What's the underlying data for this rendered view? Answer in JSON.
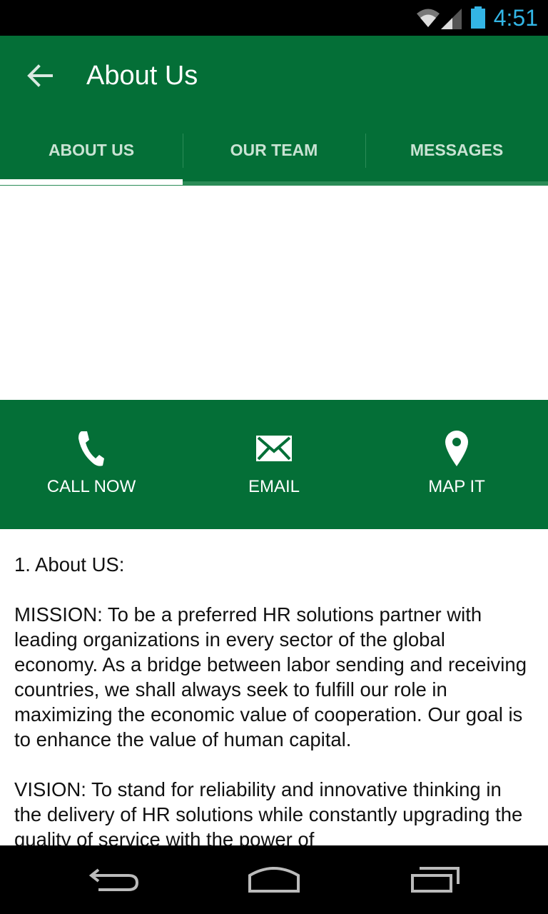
{
  "status_bar": {
    "time": "4:51"
  },
  "app_bar": {
    "title": "About Us"
  },
  "tabs": [
    {
      "label": "ABOUT US",
      "selected": true
    },
    {
      "label": "OUR TEAM",
      "selected": false
    },
    {
      "label": "MESSAGES",
      "selected": false
    }
  ],
  "actions": [
    {
      "label": "CALL NOW",
      "icon": "phone-icon"
    },
    {
      "label": "EMAIL",
      "icon": "envelope-icon"
    },
    {
      "label": "MAP IT",
      "icon": "map-pin-icon"
    }
  ],
  "content": {
    "heading": "1. About US:",
    "mission": "MISSION: To be a preferred HR solutions partner with leading organizations in every sector of the global economy. As a bridge between labor sending and receiving countries, we shall always seek to fulfill our role in maximizing the economic value of cooperation. Our goal is to enhance the value of human capital.",
    "vision": "VISION: To stand for reliability and innovative thinking in the delivery of HR solutions while constantly upgrading the quality of service with the power of"
  },
  "colors": {
    "brand_green": "#046f37",
    "status_accent": "#33b5e5",
    "tab_inactive_text": "#c9e3d3"
  }
}
